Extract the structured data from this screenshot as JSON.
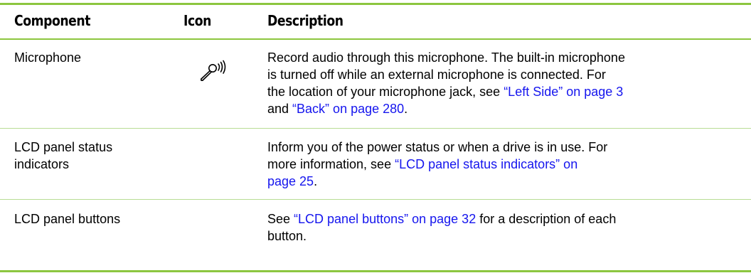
{
  "headers": {
    "component": "Component",
    "icon": "Icon",
    "description": "Description"
  },
  "rows": [
    {
      "component": "Microphone",
      "icon": "microphone-icon",
      "lines": [
        [
          {
            "t": "Record audio through this microphone. The built-in microphone"
          }
        ],
        [
          {
            "t": "is turned off while an external microphone is connected. For"
          }
        ],
        [
          {
            "t": "the location of your microphone jack, see "
          },
          {
            "t": "“Left Side” on page 3",
            "link": true
          }
        ],
        [
          {
            "t": "and "
          },
          {
            "t": "“Back” on page 280",
            "link": true
          },
          {
            "t": "."
          }
        ]
      ]
    },
    {
      "component_lines": [
        "LCD panel status",
        "indicators"
      ],
      "lines": [
        [
          {
            "t": "Inform you of the power status or when a drive is in use. For"
          }
        ],
        [
          {
            "t": "more information, see "
          },
          {
            "t": "“LCD panel status indicators” on",
            "link": true
          }
        ],
        [
          {
            "t": "page 25",
            "link": true
          },
          {
            "t": "."
          }
        ]
      ]
    },
    {
      "component": "LCD panel buttons",
      "lines": [
        [
          {
            "t": "See "
          },
          {
            "t": "“LCD panel buttons” on page 32",
            "link": true
          },
          {
            "t": " for a description of each"
          }
        ],
        [
          {
            "t": "button."
          }
        ]
      ]
    }
  ],
  "colors": {
    "rule": "#8cc63f",
    "link": "#1515ee"
  }
}
